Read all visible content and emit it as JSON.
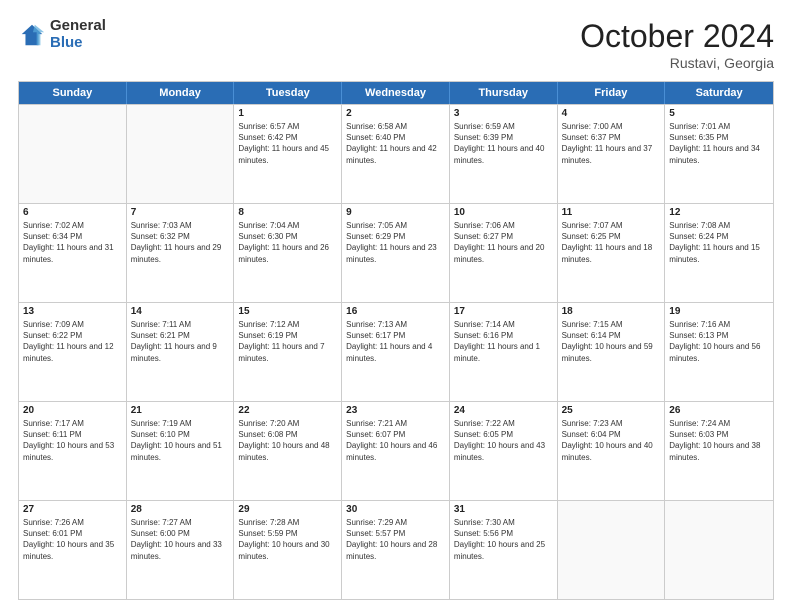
{
  "logo": {
    "general": "General",
    "blue": "Blue"
  },
  "header": {
    "month": "October 2024",
    "location": "Rustavi, Georgia"
  },
  "weekdays": [
    "Sunday",
    "Monday",
    "Tuesday",
    "Wednesday",
    "Thursday",
    "Friday",
    "Saturday"
  ],
  "rows": [
    [
      {
        "day": "",
        "sunrise": "",
        "sunset": "",
        "daylight": ""
      },
      {
        "day": "",
        "sunrise": "",
        "sunset": "",
        "daylight": ""
      },
      {
        "day": "1",
        "sunrise": "Sunrise: 6:57 AM",
        "sunset": "Sunset: 6:42 PM",
        "daylight": "Daylight: 11 hours and 45 minutes."
      },
      {
        "day": "2",
        "sunrise": "Sunrise: 6:58 AM",
        "sunset": "Sunset: 6:40 PM",
        "daylight": "Daylight: 11 hours and 42 minutes."
      },
      {
        "day": "3",
        "sunrise": "Sunrise: 6:59 AM",
        "sunset": "Sunset: 6:39 PM",
        "daylight": "Daylight: 11 hours and 40 minutes."
      },
      {
        "day": "4",
        "sunrise": "Sunrise: 7:00 AM",
        "sunset": "Sunset: 6:37 PM",
        "daylight": "Daylight: 11 hours and 37 minutes."
      },
      {
        "day": "5",
        "sunrise": "Sunrise: 7:01 AM",
        "sunset": "Sunset: 6:35 PM",
        "daylight": "Daylight: 11 hours and 34 minutes."
      }
    ],
    [
      {
        "day": "6",
        "sunrise": "Sunrise: 7:02 AM",
        "sunset": "Sunset: 6:34 PM",
        "daylight": "Daylight: 11 hours and 31 minutes."
      },
      {
        "day": "7",
        "sunrise": "Sunrise: 7:03 AM",
        "sunset": "Sunset: 6:32 PM",
        "daylight": "Daylight: 11 hours and 29 minutes."
      },
      {
        "day": "8",
        "sunrise": "Sunrise: 7:04 AM",
        "sunset": "Sunset: 6:30 PM",
        "daylight": "Daylight: 11 hours and 26 minutes."
      },
      {
        "day": "9",
        "sunrise": "Sunrise: 7:05 AM",
        "sunset": "Sunset: 6:29 PM",
        "daylight": "Daylight: 11 hours and 23 minutes."
      },
      {
        "day": "10",
        "sunrise": "Sunrise: 7:06 AM",
        "sunset": "Sunset: 6:27 PM",
        "daylight": "Daylight: 11 hours and 20 minutes."
      },
      {
        "day": "11",
        "sunrise": "Sunrise: 7:07 AM",
        "sunset": "Sunset: 6:25 PM",
        "daylight": "Daylight: 11 hours and 18 minutes."
      },
      {
        "day": "12",
        "sunrise": "Sunrise: 7:08 AM",
        "sunset": "Sunset: 6:24 PM",
        "daylight": "Daylight: 11 hours and 15 minutes."
      }
    ],
    [
      {
        "day": "13",
        "sunrise": "Sunrise: 7:09 AM",
        "sunset": "Sunset: 6:22 PM",
        "daylight": "Daylight: 11 hours and 12 minutes."
      },
      {
        "day": "14",
        "sunrise": "Sunrise: 7:11 AM",
        "sunset": "Sunset: 6:21 PM",
        "daylight": "Daylight: 11 hours and 9 minutes."
      },
      {
        "day": "15",
        "sunrise": "Sunrise: 7:12 AM",
        "sunset": "Sunset: 6:19 PM",
        "daylight": "Daylight: 11 hours and 7 minutes."
      },
      {
        "day": "16",
        "sunrise": "Sunrise: 7:13 AM",
        "sunset": "Sunset: 6:17 PM",
        "daylight": "Daylight: 11 hours and 4 minutes."
      },
      {
        "day": "17",
        "sunrise": "Sunrise: 7:14 AM",
        "sunset": "Sunset: 6:16 PM",
        "daylight": "Daylight: 11 hours and 1 minute."
      },
      {
        "day": "18",
        "sunrise": "Sunrise: 7:15 AM",
        "sunset": "Sunset: 6:14 PM",
        "daylight": "Daylight: 10 hours and 59 minutes."
      },
      {
        "day": "19",
        "sunrise": "Sunrise: 7:16 AM",
        "sunset": "Sunset: 6:13 PM",
        "daylight": "Daylight: 10 hours and 56 minutes."
      }
    ],
    [
      {
        "day": "20",
        "sunrise": "Sunrise: 7:17 AM",
        "sunset": "Sunset: 6:11 PM",
        "daylight": "Daylight: 10 hours and 53 minutes."
      },
      {
        "day": "21",
        "sunrise": "Sunrise: 7:19 AM",
        "sunset": "Sunset: 6:10 PM",
        "daylight": "Daylight: 10 hours and 51 minutes."
      },
      {
        "day": "22",
        "sunrise": "Sunrise: 7:20 AM",
        "sunset": "Sunset: 6:08 PM",
        "daylight": "Daylight: 10 hours and 48 minutes."
      },
      {
        "day": "23",
        "sunrise": "Sunrise: 7:21 AM",
        "sunset": "Sunset: 6:07 PM",
        "daylight": "Daylight: 10 hours and 46 minutes."
      },
      {
        "day": "24",
        "sunrise": "Sunrise: 7:22 AM",
        "sunset": "Sunset: 6:05 PM",
        "daylight": "Daylight: 10 hours and 43 minutes."
      },
      {
        "day": "25",
        "sunrise": "Sunrise: 7:23 AM",
        "sunset": "Sunset: 6:04 PM",
        "daylight": "Daylight: 10 hours and 40 minutes."
      },
      {
        "day": "26",
        "sunrise": "Sunrise: 7:24 AM",
        "sunset": "Sunset: 6:03 PM",
        "daylight": "Daylight: 10 hours and 38 minutes."
      }
    ],
    [
      {
        "day": "27",
        "sunrise": "Sunrise: 7:26 AM",
        "sunset": "Sunset: 6:01 PM",
        "daylight": "Daylight: 10 hours and 35 minutes."
      },
      {
        "day": "28",
        "sunrise": "Sunrise: 7:27 AM",
        "sunset": "Sunset: 6:00 PM",
        "daylight": "Daylight: 10 hours and 33 minutes."
      },
      {
        "day": "29",
        "sunrise": "Sunrise: 7:28 AM",
        "sunset": "Sunset: 5:59 PM",
        "daylight": "Daylight: 10 hours and 30 minutes."
      },
      {
        "day": "30",
        "sunrise": "Sunrise: 7:29 AM",
        "sunset": "Sunset: 5:57 PM",
        "daylight": "Daylight: 10 hours and 28 minutes."
      },
      {
        "day": "31",
        "sunrise": "Sunrise: 7:30 AM",
        "sunset": "Sunset: 5:56 PM",
        "daylight": "Daylight: 10 hours and 25 minutes."
      },
      {
        "day": "",
        "sunrise": "",
        "sunset": "",
        "daylight": ""
      },
      {
        "day": "",
        "sunrise": "",
        "sunset": "",
        "daylight": ""
      }
    ]
  ]
}
